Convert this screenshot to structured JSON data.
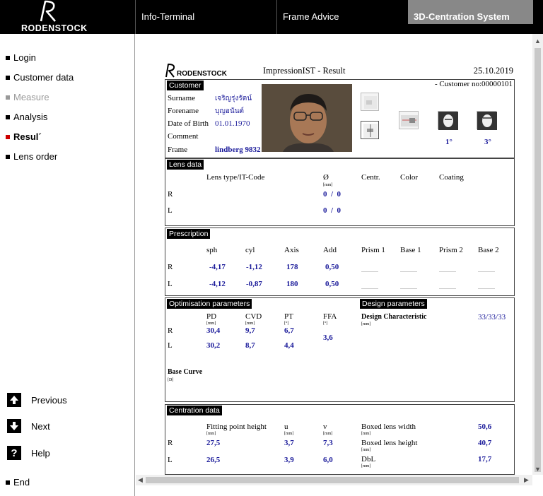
{
  "header": {
    "brand": "RODENSTOCK",
    "tabs": [
      {
        "label": "Info-Terminal"
      },
      {
        "label": "Frame Advice"
      },
      {
        "label": "3D-Centration System"
      }
    ]
  },
  "sidebar": {
    "items": [
      {
        "label": "Login"
      },
      {
        "label": "Customer data"
      },
      {
        "label": "Measure"
      },
      {
        "label": "Analysis"
      },
      {
        "label": "Resul´"
      },
      {
        "label": "Lens order"
      }
    ],
    "previous": "Previous",
    "next": "Next",
    "help": "Help",
    "help_glyph": "?",
    "end": "End"
  },
  "doc": {
    "brand": "RODENSTOCK",
    "title": "ImpressionIST - Result",
    "date": "25.10.2019",
    "customer": {
      "label": "Customer",
      "customer_no": "- Customer no:00000101",
      "surname_label": "Surname",
      "surname": "เจริญรุ่งรัตน์",
      "forename_label": "Forename",
      "forename": "บุญอนันต์",
      "dob_label": "Date of Birth",
      "dob": "01.01.1970",
      "comment_label": "Comment",
      "frame_label": "Frame",
      "frame": "lindberg 9832",
      "angle_1": "1°",
      "angle_2": "3°"
    },
    "lens": {
      "label": "Lens data",
      "col_type": "Lens type/IT-Code",
      "col_dia": "Ø",
      "unit_mm": "[mm]",
      "col_centr": "Centr.",
      "col_color": "Color",
      "col_coating": "Coating",
      "row_r": "R",
      "row_l": "L",
      "r_dia": "0  /  0",
      "l_dia": "0  /  0"
    },
    "prescription": {
      "label": "Prescription",
      "headers": [
        "sph",
        "cyl",
        "Axis",
        "Add",
        "Prism 1",
        "Base 1",
        "Prism 2",
        "Base 2"
      ],
      "row_r": "R",
      "row_l": "L",
      "r": [
        "-4,17",
        "-1,12",
        "178",
        "0,50"
      ],
      "l": [
        "-4,12",
        "-0,87",
        "180",
        "0,50"
      ]
    },
    "optimisation": {
      "label": "Optimisation parameters",
      "design_label": "Design parameters",
      "col_pd": "PD",
      "col_cvd": "CVD",
      "col_pt": "PT",
      "col_ffa": "FFA",
      "unit_mm": "[mm]",
      "unit_deg": "[°]",
      "row_r": "R",
      "row_l": "L",
      "r_pd": "30,4",
      "r_cvd": "9,7",
      "r_pt": "6,7",
      "l_pd": "30,2",
      "l_cvd": "8,7",
      "l_pt": "4,4",
      "ffa": "3,6",
      "design_char": "Design Characteristic",
      "design_value": "33/33/33",
      "base_curve": "Base Curve",
      "unit_d": "[D]"
    },
    "centration": {
      "label": "Centration data",
      "col_fph": "Fitting point height",
      "col_u": "u",
      "col_v": "v",
      "unit_mm": "[mm]",
      "row_r": "R",
      "row_l": "L",
      "r_fph": "27,5",
      "r_u": "3,7",
      "r_v": "7,3",
      "l_fph": "26,5",
      "l_u": "3,9",
      "l_v": "6,0",
      "boxed_width": "Boxed lens width",
      "boxed_width_val": "50,6",
      "boxed_height": "Boxed lens height",
      "boxed_height_val": "40,7",
      "dbl": "DbL",
      "dbl_val": "17,7"
    }
  },
  "colors": {
    "value_blue": "#1a1a9a",
    "active_red": "#c00000",
    "active_tab_gray": "#888888"
  }
}
